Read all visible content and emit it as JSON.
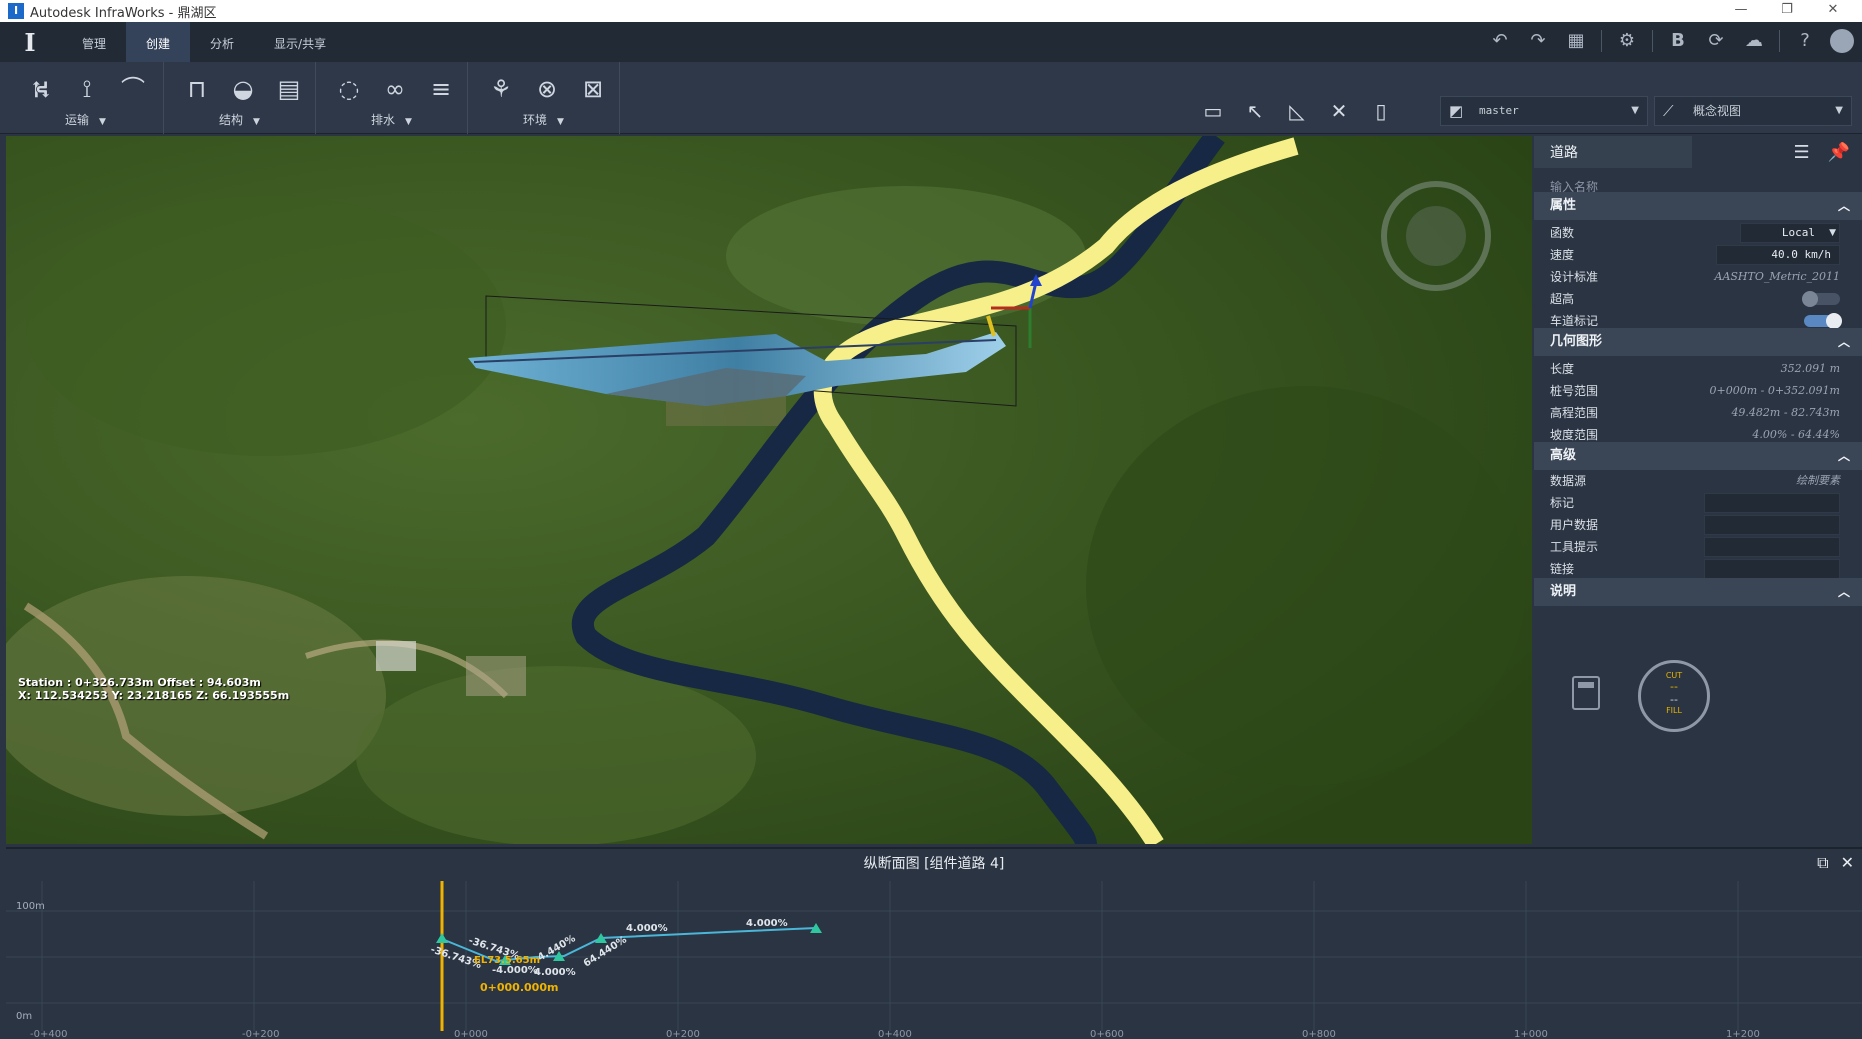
{
  "window": {
    "title": "Autodesk InfraWorks - 鼎湖区",
    "controls": [
      "—",
      "❐",
      "✕"
    ]
  },
  "menu": {
    "tabs": [
      "管理",
      "创建",
      "分析",
      "显示/共享"
    ],
    "active_index": 1
  },
  "ribbon": {
    "groups": [
      {
        "label": "运输",
        "icons": [
          "road-icon",
          "intersection-icon",
          "bridge-icon"
        ]
      },
      {
        "label": "结构",
        "icons": [
          "building-icon",
          "city-furniture-icon",
          "tree-icon"
        ]
      },
      {
        "label": "排水",
        "icons": [
          "pipe-icon",
          "culvert-icon",
          "inlet-icon"
        ]
      },
      {
        "label": "环境",
        "icons": [
          "water-area-icon",
          "coverage-icon",
          "terrain-icon"
        ]
      }
    ],
    "proposal_dropdown": "master",
    "view_dropdown": "概念视图"
  },
  "viewport": {
    "coord_line1": "Station : 0+326.733m  Offset : 94.603m",
    "coord_line2": "X: 112.534253  Y: 23.218165  Z: 66.193555m",
    "road_colors": {
      "navy": "#162844",
      "yellow": "#f6ef8a"
    }
  },
  "panel": {
    "tab_title": "道路",
    "name_placeholder": "输入名称",
    "sections": {
      "properties": {
        "title": "属性",
        "rows": [
          {
            "key": "函数",
            "value": "Local",
            "kind": "select"
          },
          {
            "key": "速度",
            "value": "40.0  km/h",
            "kind": "input"
          },
          {
            "key": "设计标准",
            "value": "AASHTO_Metric_2011",
            "kind": "text"
          },
          {
            "key": "超高",
            "value": "",
            "kind": "toggle-off"
          },
          {
            "key": "车道标记",
            "value": "",
            "kind": "toggle-on"
          }
        ]
      },
      "geometry": {
        "title": "几何图形",
        "rows": [
          {
            "key": "长度",
            "value": "352.091  m"
          },
          {
            "key": "桩号范围",
            "value": "0+000m - 0+352.091m"
          },
          {
            "key": "高程范围",
            "value": "49.482m - 82.743m"
          },
          {
            "key": "坡度范围",
            "value": "4.00% - 64.44%"
          }
        ]
      },
      "advanced": {
        "title": "高级",
        "rows": [
          {
            "key": "数据源",
            "value": "绘制要素",
            "kind": "text"
          },
          {
            "key": "标记",
            "value": "",
            "kind": "input"
          },
          {
            "key": "用户数据",
            "value": "",
            "kind": "input"
          },
          {
            "key": "工具提示",
            "value": "",
            "kind": "input"
          },
          {
            "key": "链接",
            "value": "",
            "kind": "input"
          }
        ]
      },
      "notes": {
        "title": "说明"
      }
    },
    "cutfill": {
      "cut": "CUT",
      "fill": "FILL",
      "cut_value": "--",
      "fill_value": "--"
    }
  },
  "profile": {
    "title": "纵断面图 [组件道路 4]",
    "y_labels": [
      "100m",
      "0m"
    ],
    "x_labels": [
      "-0+400",
      "-0+200",
      "0+000",
      "0+200",
      "0+400",
      "0+600",
      "0+800",
      "1+000",
      "1+200"
    ],
    "station_label": "0+000.000m",
    "grade_labels": [
      "-36.743%",
      "-36.743%",
      "EL73.5.65m",
      "-4.000%",
      "4.000%",
      "64.440%",
      "4.440%",
      "4.000%",
      "4.000%"
    ]
  }
}
